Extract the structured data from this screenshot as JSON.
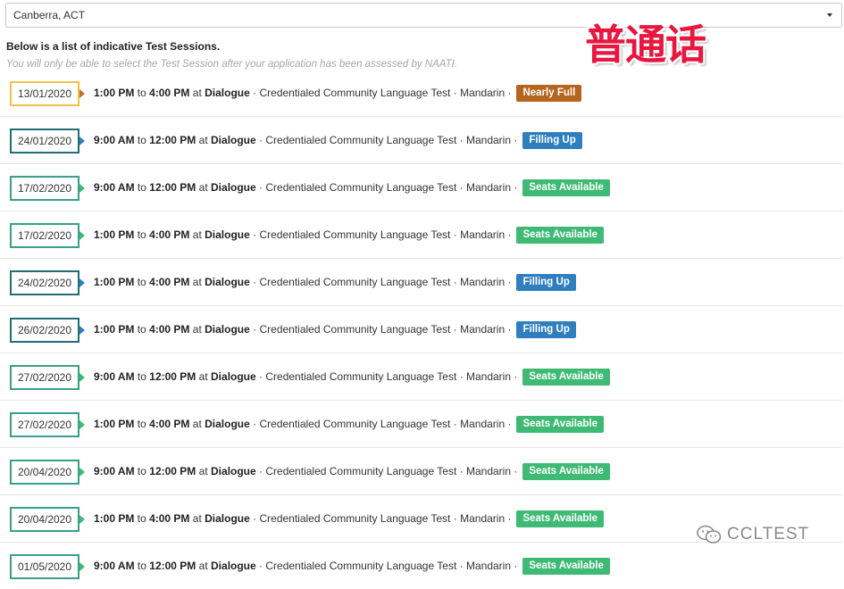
{
  "location": {
    "selected": "Canberra, ACT"
  },
  "intro": {
    "title": "Below is a list of indicative Test Sessions.",
    "note": "You will only be able to select the Test Session after your application has been assessed by NAATI."
  },
  "watermark": {
    "chinese": "普通话",
    "brand": "CCLTEST"
  },
  "separators": {
    "to": "to",
    "at": "at",
    "dot": "·"
  },
  "colors": {
    "nearly_full": "#b5651d",
    "filling_up": "#2f7fbf",
    "seats_available": "#3fba74"
  },
  "sessions": [
    {
      "date": "13/01/2020",
      "start": "1:00 PM",
      "end": "4:00 PM",
      "venue": "Dialogue",
      "test": "Credentialed Community Language Test",
      "language": "Mandarin",
      "status": "Nearly Full",
      "style": "yellow",
      "status_key": "nearly_full"
    },
    {
      "date": "24/01/2020",
      "start": "9:00 AM",
      "end": "12:00 PM",
      "venue": "Dialogue",
      "test": "Credentialed Community Language Test",
      "language": "Mandarin",
      "status": "Filling Up",
      "style": "teal-dark",
      "status_key": "filling_up"
    },
    {
      "date": "17/02/2020",
      "start": "9:00 AM",
      "end": "12:00 PM",
      "venue": "Dialogue",
      "test": "Credentialed Community Language Test",
      "language": "Mandarin",
      "status": "Seats Available",
      "style": "green",
      "status_key": "seats_available"
    },
    {
      "date": "17/02/2020",
      "start": "1:00 PM",
      "end": "4:00 PM",
      "venue": "Dialogue",
      "test": "Credentialed Community Language Test",
      "language": "Mandarin",
      "status": "Seats Available",
      "style": "green",
      "status_key": "seats_available"
    },
    {
      "date": "24/02/2020",
      "start": "1:00 PM",
      "end": "4:00 PM",
      "venue": "Dialogue",
      "test": "Credentialed Community Language Test",
      "language": "Mandarin",
      "status": "Filling Up",
      "style": "teal-dark",
      "status_key": "filling_up"
    },
    {
      "date": "26/02/2020",
      "start": "1:00 PM",
      "end": "4:00 PM",
      "venue": "Dialogue",
      "test": "Credentialed Community Language Test",
      "language": "Mandarin",
      "status": "Filling Up",
      "style": "teal-dark",
      "status_key": "filling_up"
    },
    {
      "date": "27/02/2020",
      "start": "9:00 AM",
      "end": "12:00 PM",
      "venue": "Dialogue",
      "test": "Credentialed Community Language Test",
      "language": "Mandarin",
      "status": "Seats Available",
      "style": "green",
      "status_key": "seats_available"
    },
    {
      "date": "27/02/2020",
      "start": "1:00 PM",
      "end": "4:00 PM",
      "venue": "Dialogue",
      "test": "Credentialed Community Language Test",
      "language": "Mandarin",
      "status": "Seats Available",
      "style": "green",
      "status_key": "seats_available"
    },
    {
      "date": "20/04/2020",
      "start": "9:00 AM",
      "end": "12:00 PM",
      "venue": "Dialogue",
      "test": "Credentialed Community Language Test",
      "language": "Mandarin",
      "status": "Seats Available",
      "style": "green",
      "status_key": "seats_available"
    },
    {
      "date": "20/04/2020",
      "start": "1:00 PM",
      "end": "4:00 PM",
      "venue": "Dialogue",
      "test": "Credentialed Community Language Test",
      "language": "Mandarin",
      "status": "Seats Available",
      "style": "green",
      "status_key": "seats_available"
    },
    {
      "date": "01/05/2020",
      "start": "9:00 AM",
      "end": "12:00 PM",
      "venue": "Dialogue",
      "test": "Credentialed Community Language Test",
      "language": "Mandarin",
      "status": "Seats Available",
      "style": "green",
      "status_key": "seats_available"
    }
  ]
}
